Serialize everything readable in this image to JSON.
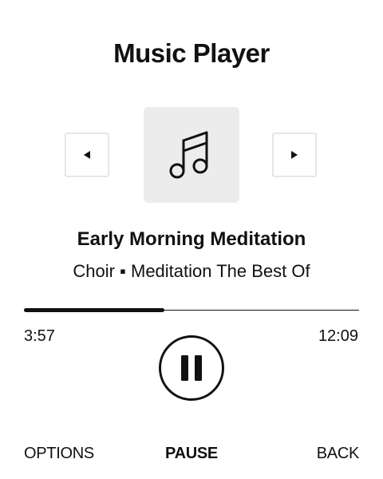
{
  "header": {
    "title": "Music Player"
  },
  "controls": {
    "prev_icon": "triangle-left-icon",
    "next_icon": "triangle-right-icon",
    "album_art_icon": "music-note-icon",
    "play_pause_icon": "pause-icon"
  },
  "track": {
    "title": "Early Morning Meditation",
    "subtitle": "Choir ▪ Meditation The Best Of"
  },
  "playback": {
    "elapsed": "3:57",
    "total": "12:09",
    "progress_fraction": 0.42
  },
  "softkeys": {
    "left": "OPTIONS",
    "center": "PAUSE",
    "right": "BACK"
  },
  "colors": {
    "text": "#111111",
    "art_background": "#ececec",
    "button_border": "#e6e6e6"
  }
}
